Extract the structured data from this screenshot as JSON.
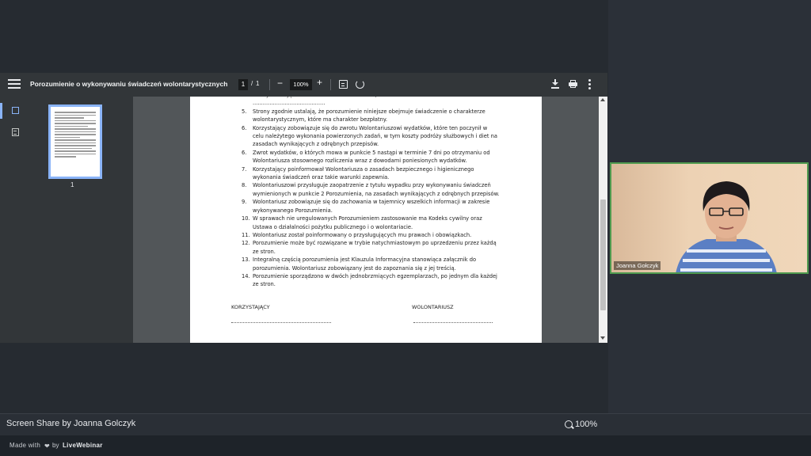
{
  "viewer": {
    "title": "Porozumienie o wykonywaniu świadczeń wolontarystycznych",
    "page_current": "1",
    "page_sep": "/",
    "page_total": "1",
    "zoom": "100%",
    "zoom_out_label": "−",
    "zoom_in_label": "+",
    "thumbnail_label": "1"
  },
  "document": {
    "first_line": "strony ustalają na dzień ................................. , a zakończenie do dnia ...........................................",
    "items": [
      {
        "num": "5.",
        "text": "Strony zgodnie ustalają, że porozumienie niniejsze obejmuje świadczenie o charakterze\nwolontarystycznym, które ma charakter bezpłatny."
      },
      {
        "num": "6.",
        "text": "Korzystający zobowiązuje się do zwrotu Wolontariuszowi wydatków, które ten poczynił w\ncelu należytego wykonania powierzonych zadań, w tym koszty podróży służbowych i diet na\nzasadach wynikających z odrębnych przepisów."
      },
      {
        "num": "6.",
        "text": "Zwrot wydatków, o których mowa w punkcie 5 nastąpi w terminie 7 dni po otrzymaniu od\nWolontariusza stosownego rozliczenia wraz z dowodami poniesionych wydatków."
      },
      {
        "num": "7.",
        "text": "Korzystający poinformował Wolontariusza o zasadach bezpiecznego i higienicznego\nwykonania świadczeń oraz takie warunki zapewnia."
      },
      {
        "num": "8.",
        "text": "Wolontariuszowi przysługuje zaopatrzenie z tytułu wypadku przy wykonywaniu świadczeń\nwymienionych w punkcie 2 Porozumienia, na zasadach wynikających z odrębnych przepisów."
      },
      {
        "num": "9.",
        "text": "Wolontariusz zobowiązuje się do zachowania w tajemnicy wszelkich informacji w zakresie\nwykonywanego Porozumienia."
      },
      {
        "num": "10.",
        "text": "W sprawach nie uregulowanych Porozumieniem zastosowanie ma Kodeks cywilny oraz\nUstawa o działalności pożytku publicznego i o wolontariacie."
      },
      {
        "num": "11.",
        "text": "Wolontariusz został poinformowany o przysługujących mu prawach i obowiązkach."
      },
      {
        "num": "12.",
        "text": "Porozumienie może być rozwiązane w trybie natychmiastowym po uprzedzeniu przez każdą\nze stron."
      },
      {
        "num": "13.",
        "text": "Integralną częścią porozumienia jest Klauzula Informacyjna stanowiąca załącznik do\nporozumienia. Wolontariusz zobowiązany jest do zapoznania się z jej treścią."
      },
      {
        "num": "14.",
        "text": "Porozumienie sporządzono w dwóch jednobrzmiących egzemplarzach, po jednym dla każdej\nze stron."
      }
    ],
    "sig_left": "KORZYSTAJĄCY",
    "sig_right": "WOLONTARIUSZ"
  },
  "webcam": {
    "name": "Joanna Gołczyk"
  },
  "share_bar": {
    "label": "Screen Share by Joanna Golczyk",
    "zoom": "100%"
  },
  "footer": {
    "made_with": "Made with",
    "by": "by",
    "brand": "LiveWebinar"
  },
  "colors": {
    "accent": "#8ab4f8",
    "webcam_border": "#4e9a4e"
  }
}
